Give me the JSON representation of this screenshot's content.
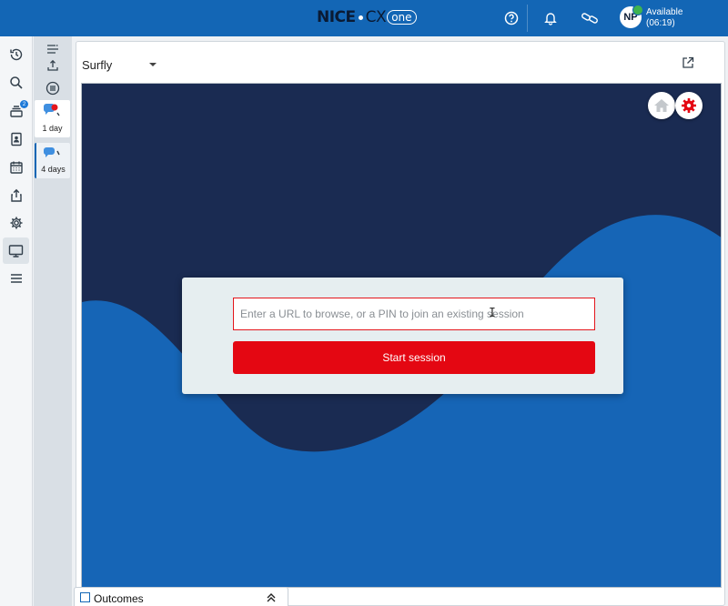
{
  "topbar": {
    "brand_nice": "NICE",
    "brand_cx": "CX",
    "brand_one": "one",
    "help_icon": "help-circle-icon",
    "bell_icon": "bell-icon",
    "link_icon": "link-icon",
    "avatar_initials": "NP",
    "status_label": "Available",
    "status_timer": "(06:19)",
    "status_color": "#3fb34f",
    "accent": "#1366b5"
  },
  "leftnav": {
    "items": [
      {
        "icon": "history-icon"
      },
      {
        "icon": "search-icon"
      },
      {
        "icon": "queue-icon",
        "badge": "2"
      },
      {
        "icon": "address-book-icon"
      },
      {
        "icon": "calendar-icon"
      },
      {
        "icon": "share-icon"
      },
      {
        "icon": "gear-icon"
      },
      {
        "icon": "monitor-icon"
      },
      {
        "icon": "menu-icon"
      }
    ]
  },
  "contacts": {
    "cards": [
      {
        "label": "1 day"
      },
      {
        "label": "4 days"
      }
    ]
  },
  "panel": {
    "app_select": "Surfly",
    "popout_icon": "external-link-icon"
  },
  "surfly": {
    "home_icon": "home-icon",
    "settings_icon": "gear-icon",
    "url_placeholder": "Enter a URL to browse, or a PIN to join an existing session",
    "start_label": "Start session",
    "brand_red": "#e40712",
    "bg_dark": "#1a2b52",
    "bg_wave": "#1665b6"
  },
  "footer": {
    "outcomes_label": "Outcomes"
  }
}
